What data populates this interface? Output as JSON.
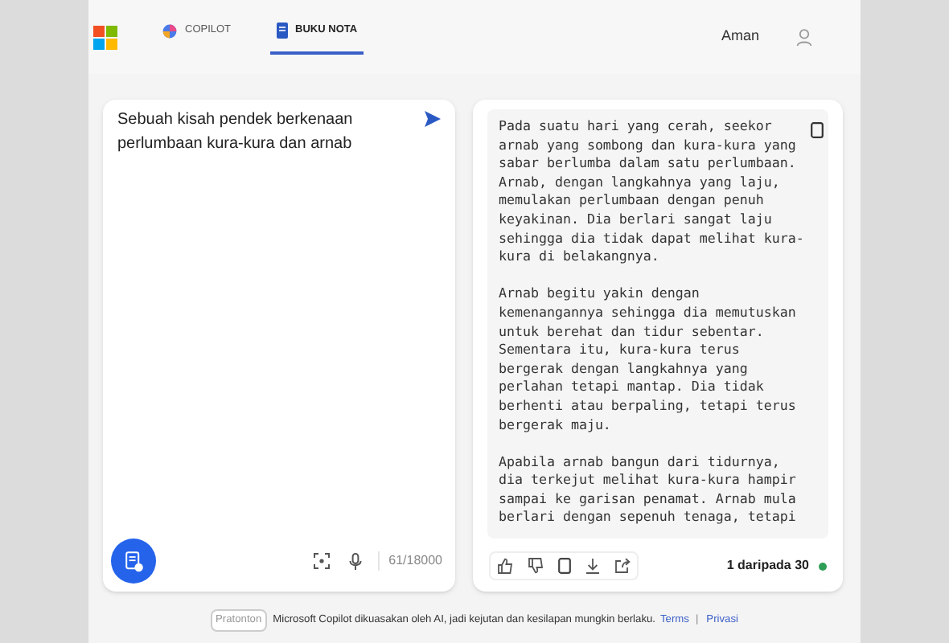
{
  "header": {
    "tabs": [
      {
        "label": "COPILOT",
        "selected": false
      },
      {
        "label": "BUKU NOTA",
        "selected": true
      }
    ],
    "user": {
      "name": "Aman"
    }
  },
  "prompt": {
    "value": "Sebuah kisah pendek berkenaan perlumbaan kura-kura dan arnab",
    "counter": "61/18000"
  },
  "response": {
    "paragraphs": [
      "Pada suatu hari yang cerah, seekor arnab yang sombong dan kura-kura yang sabar berlumba dalam satu perlumbaan. Arnab, dengan langkahnya yang laju, memulakan perlumbaan dengan penuh keyakinan. Dia berlari sangat laju sehingga dia tidak dapat melihat kura-kura di belakangnya.",
      "Arnab begitu yakin dengan kemenangannya sehingga dia memutuskan untuk berehat dan tidur sebentar. Sementara itu, kura-kura terus bergerak dengan langkahnya yang perlahan tetapi mantap. Dia tidak berhenti atau berpaling, tetapi terus bergerak maju.",
      "Apabila arnab bangun dari tidurnya, dia terkejut melihat kura-kura hampir sampai ke garisan penamat. Arnab mula berlari dengan sepenuh tenaga, tetapi"
    ],
    "page": "1 daripada 30"
  },
  "footer": {
    "badge": "Pratonton",
    "notice": "Microsoft Copilot dikuasakan oleh AI, jadi kejutan dan kesilapan mungkin berlaku.",
    "links": [
      "Terms",
      "Privasi"
    ],
    "separator": "|"
  }
}
